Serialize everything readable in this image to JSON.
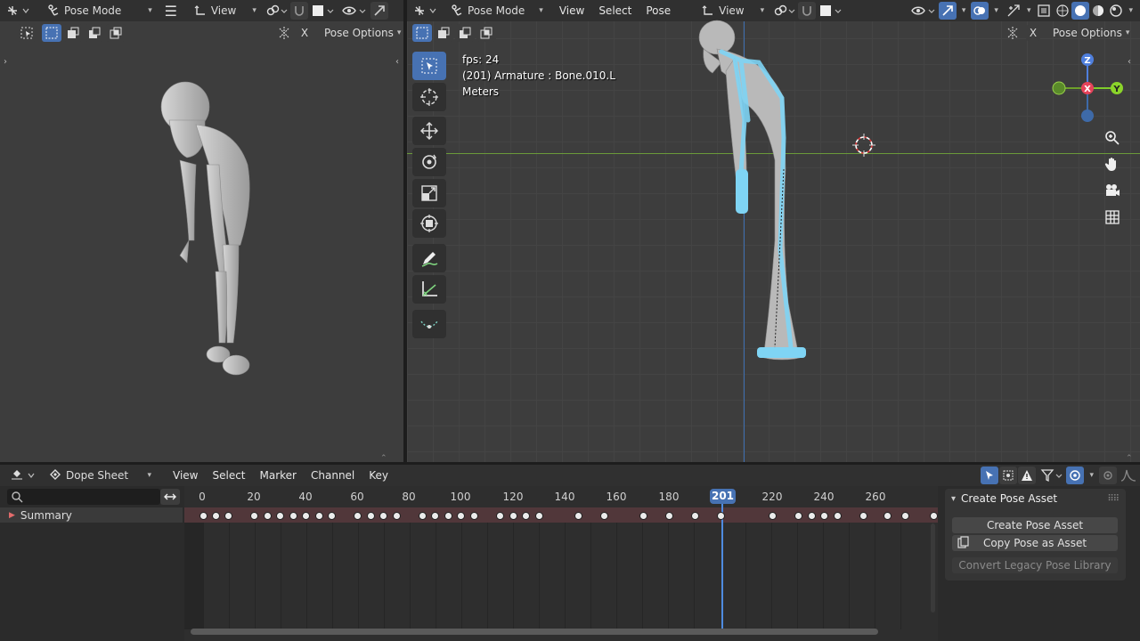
{
  "left_view": {
    "mode": "Pose Mode",
    "menu_view": "View",
    "pose_options": "Pose Options",
    "close_x": "X"
  },
  "main_view": {
    "mode": "Pose Mode",
    "menus": [
      "View",
      "Select",
      "Pose"
    ],
    "view_dd": "View",
    "pose_options": "Pose Options",
    "close_x": "X",
    "overlay_lines": [
      "fps: 24",
      "(201) Armature : Bone.010.L",
      "Meters"
    ],
    "gizmo": {
      "z": "Z",
      "x": "X",
      "y": "Y"
    }
  },
  "dopesheet": {
    "editor_name": "Dope Sheet",
    "menus": [
      "View",
      "Select",
      "Marker",
      "Channel",
      "Key"
    ],
    "channel": "Summary",
    "current_frame": "201",
    "ticks": [
      "0",
      "20",
      "40",
      "60",
      "80",
      "100",
      "120",
      "140",
      "160",
      "180",
      "220",
      "240",
      "260"
    ]
  },
  "pose_panel": {
    "title": "Create Pose Asset",
    "btn_create": "Create Pose Asset",
    "btn_copy": "Copy Pose as Asset",
    "btn_convert": "Convert Legacy Pose Library"
  },
  "colors": {
    "accent": "#4772b3",
    "bone": "#7fd4f4",
    "grid": "#3a3a3a",
    "horizon": "#6a9a3a"
  }
}
